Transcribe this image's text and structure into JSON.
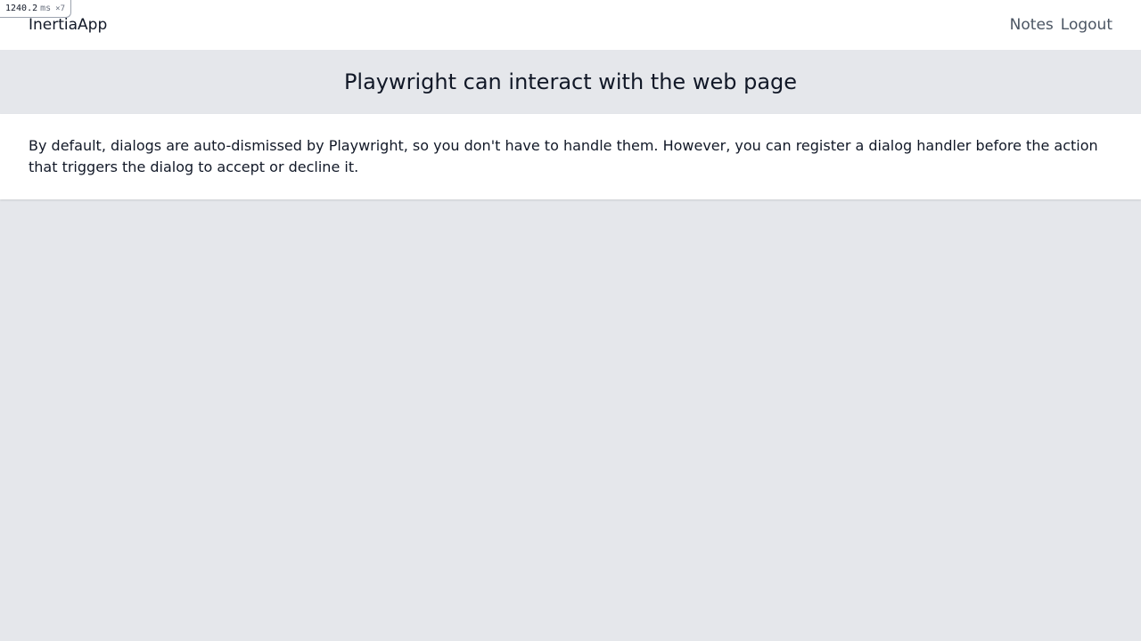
{
  "debug": {
    "time_value": "1240.2",
    "time_unit": "ms",
    "count": "×7"
  },
  "navbar": {
    "brand": "InertiaApp",
    "links": [
      {
        "label": "Notes"
      },
      {
        "label": "Logout"
      }
    ]
  },
  "header": {
    "title": "Playwright can interact with the web page"
  },
  "content": {
    "text": "By default, dialogs are auto-dismissed by Playwright, so you don't have to handle them. However, you can register a dialog handler before the action that triggers the dialog to accept or decline it."
  },
  "colors": {
    "background": "#e5e7eb",
    "surface": "#ffffff",
    "text": "#111827",
    "link": "#4b5563"
  }
}
